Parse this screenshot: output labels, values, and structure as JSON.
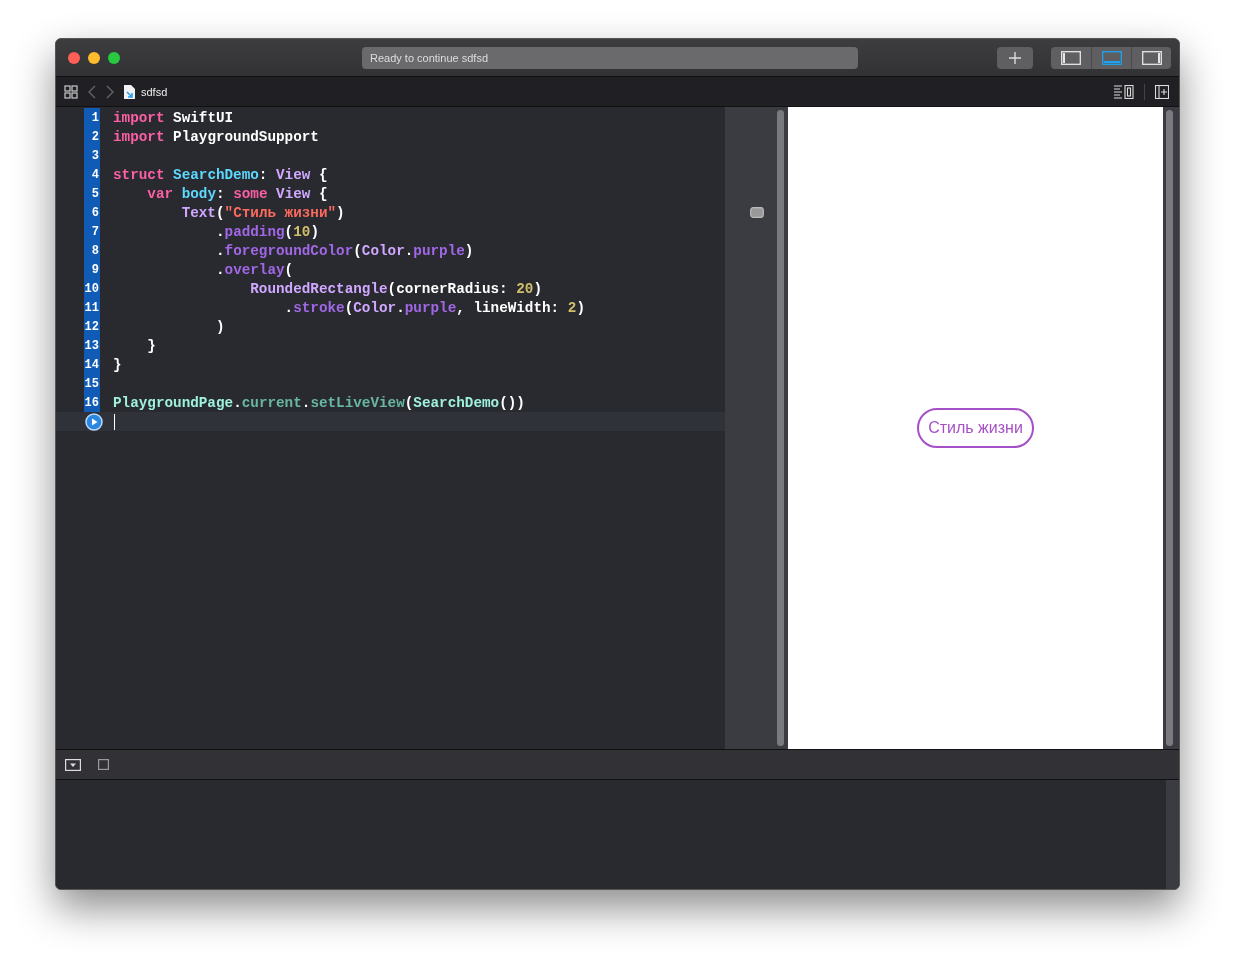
{
  "window": {
    "title": "Ready to continue sdfsd"
  },
  "toolbar": {
    "layout_buttons": [
      {
        "selected": false
      },
      {
        "selected": true
      },
      {
        "selected": false
      }
    ]
  },
  "jump_bar": {
    "file": "sdfsd"
  },
  "code": {
    "lines": [
      {
        "kind": "numbered",
        "number": "1",
        "current": false,
        "tokens": [
          {
            "kind": "keyword",
            "text": "import"
          },
          {
            "kind": "plain",
            "text": " SwiftUI"
          }
        ]
      },
      {
        "kind": "numbered",
        "number": "2",
        "current": false,
        "tokens": [
          {
            "kind": "keyword",
            "text": "import"
          },
          {
            "kind": "plain",
            "text": " PlaygroundSupport"
          }
        ]
      },
      {
        "kind": "numbered",
        "number": "3",
        "current": false
      },
      {
        "kind": "numbered",
        "number": "4",
        "current": false,
        "tokens": [
          {
            "kind": "keyword",
            "text": "struct"
          },
          {
            "kind": "decl",
            "text": " SearchDemo"
          },
          {
            "kind": "plain",
            "text": ": "
          },
          {
            "kind": "type",
            "text": "View"
          },
          {
            "kind": "plain",
            "text": " {"
          }
        ]
      },
      {
        "kind": "numbered",
        "number": "5",
        "current": false,
        "tokens": [
          {
            "kind": "keyword",
            "text": "    var"
          },
          {
            "kind": "decl",
            "text": " body"
          },
          {
            "kind": "plain",
            "text": ": "
          },
          {
            "kind": "keyword",
            "text": "some"
          },
          {
            "kind": "type",
            "text": " View"
          },
          {
            "kind": "plain",
            "text": " {"
          }
        ]
      },
      {
        "kind": "numbered",
        "number": "6",
        "current": false,
        "tokens": [
          {
            "kind": "type",
            "text": "        Text"
          },
          {
            "kind": "plain",
            "text": "("
          },
          {
            "kind": "string",
            "text": "\"Стиль жизни\""
          },
          {
            "kind": "plain",
            "text": ")"
          }
        ]
      },
      {
        "kind": "numbered",
        "number": "7",
        "current": false,
        "tokens": [
          {
            "kind": "plain",
            "text": "            ."
          },
          {
            "kind": "method",
            "text": "padding"
          },
          {
            "kind": "plain",
            "text": "("
          },
          {
            "kind": "number",
            "text": "10"
          },
          {
            "kind": "plain",
            "text": ")"
          }
        ]
      },
      {
        "kind": "numbered",
        "number": "8",
        "current": false,
        "tokens": [
          {
            "kind": "plain",
            "text": "            ."
          },
          {
            "kind": "method",
            "text": "foregroundColor"
          },
          {
            "kind": "plain",
            "text": "("
          },
          {
            "kind": "type",
            "text": "Color"
          },
          {
            "kind": "plain",
            "text": "."
          },
          {
            "kind": "method",
            "text": "purple"
          },
          {
            "kind": "plain",
            "text": ")"
          }
        ]
      },
      {
        "kind": "numbered",
        "number": "9",
        "current": false,
        "tokens": [
          {
            "kind": "plain",
            "text": "            ."
          },
          {
            "kind": "method",
            "text": "overlay"
          },
          {
            "kind": "plain",
            "text": "("
          }
        ]
      },
      {
        "kind": "numbered",
        "number": "10",
        "current": false,
        "tokens": [
          {
            "kind": "type",
            "text": "                RoundedRectangle"
          },
          {
            "kind": "plain",
            "text": "(cornerRadius: "
          },
          {
            "kind": "number",
            "text": "20"
          },
          {
            "kind": "plain",
            "text": ")"
          }
        ]
      },
      {
        "kind": "numbered",
        "number": "11",
        "current": false,
        "tokens": [
          {
            "kind": "plain",
            "text": "                    ."
          },
          {
            "kind": "method",
            "text": "stroke"
          },
          {
            "kind": "plain",
            "text": "("
          },
          {
            "kind": "type",
            "text": "Color"
          },
          {
            "kind": "plain",
            "text": "."
          },
          {
            "kind": "method",
            "text": "purple"
          },
          {
            "kind": "plain",
            "text": ", lineWidth: "
          },
          {
            "kind": "number",
            "text": "2"
          },
          {
            "kind": "plain",
            "text": ")"
          }
        ]
      },
      {
        "kind": "numbered",
        "number": "12",
        "current": false,
        "tokens": [
          {
            "kind": "plain",
            "text": "            )"
          }
        ]
      },
      {
        "kind": "numbered",
        "number": "13",
        "current": false,
        "tokens": [
          {
            "kind": "plain",
            "text": "    }"
          }
        ]
      },
      {
        "kind": "numbered",
        "number": "14",
        "current": false,
        "tokens": [
          {
            "kind": "plain",
            "text": "}"
          }
        ]
      },
      {
        "kind": "numbered",
        "number": "15",
        "current": false
      },
      {
        "kind": "numbered",
        "number": "16",
        "current": false,
        "tokens": [
          {
            "kind": "project",
            "text": "PlaygroundPage"
          },
          {
            "kind": "plain",
            "text": "."
          },
          {
            "kind": "project-method",
            "text": "current"
          },
          {
            "kind": "plain",
            "text": "."
          },
          {
            "kind": "project-method",
            "text": "setLiveView"
          },
          {
            "kind": "plain",
            "text": "("
          },
          {
            "kind": "project",
            "text": "SearchDemo"
          },
          {
            "kind": "plain",
            "text": "())"
          }
        ]
      },
      {
        "kind": "run",
        "current": true
      }
    ]
  },
  "live_view": {
    "label": "Стиль жизни"
  }
}
